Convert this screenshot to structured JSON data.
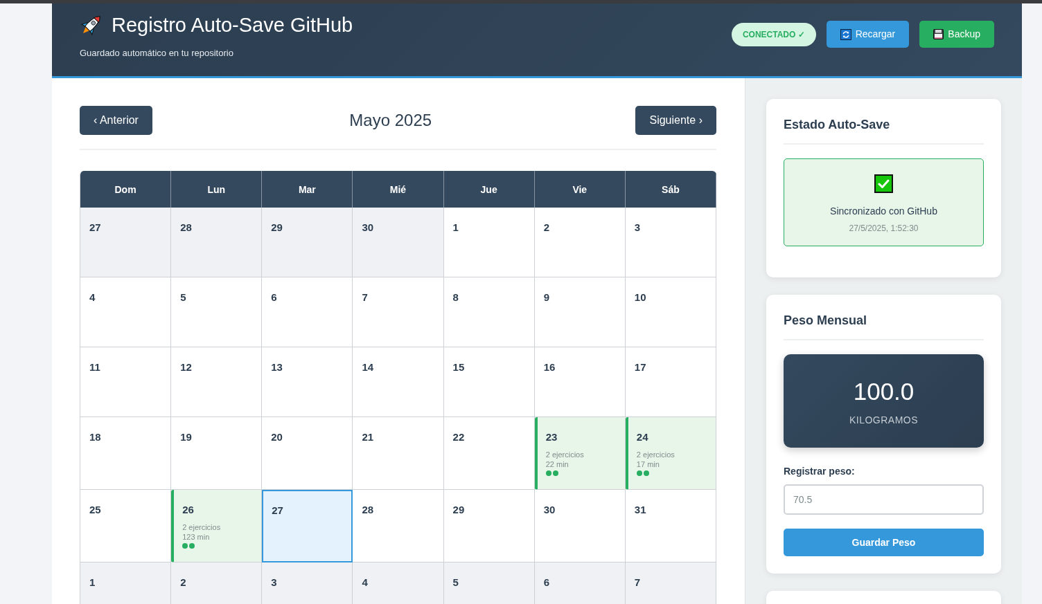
{
  "header": {
    "title": "Registro Auto-Save GitHub",
    "subtitle": "Guardado automático en tu repositorio",
    "status": {
      "label": "CONECTADO ✓",
      "connected": true
    },
    "buttons": [
      {
        "kind": "reload",
        "label": "Recargar"
      },
      {
        "kind": "backup",
        "label": "Backup"
      }
    ]
  },
  "calendar": {
    "prev": "‹ Anterior",
    "month": "Mayo 2025",
    "next": "Siguiente ›",
    "weekdays": [
      "Dom",
      "Lun",
      "Mar",
      "Mié",
      "Jue",
      "Vie",
      "Sáb"
    ],
    "weeks": [
      [
        {
          "day": "27",
          "outside": true,
          "today": false
        },
        {
          "day": "28",
          "outside": true,
          "today": false
        },
        {
          "day": "29",
          "outside": true,
          "today": false
        },
        {
          "day": "30",
          "outside": true,
          "today": false
        },
        {
          "day": "1",
          "outside": false,
          "today": false
        },
        {
          "day": "2",
          "outside": false,
          "today": false
        },
        {
          "day": "3",
          "outside": false,
          "today": false
        }
      ],
      [
        {
          "day": "4",
          "outside": false,
          "today": false
        },
        {
          "day": "5",
          "outside": false,
          "today": false
        },
        {
          "day": "6",
          "outside": false,
          "today": false
        },
        {
          "day": "7",
          "outside": false,
          "today": false
        },
        {
          "day": "8",
          "outside": false,
          "today": false
        },
        {
          "day": "9",
          "outside": false,
          "today": false
        },
        {
          "day": "10",
          "outside": false,
          "today": false
        }
      ],
      [
        {
          "day": "11",
          "outside": false,
          "today": false
        },
        {
          "day": "12",
          "outside": false,
          "today": false
        },
        {
          "day": "13",
          "outside": false,
          "today": false
        },
        {
          "day": "14",
          "outside": false,
          "today": false
        },
        {
          "day": "15",
          "outside": false,
          "today": false
        },
        {
          "day": "16",
          "outside": false,
          "today": false
        },
        {
          "day": "17",
          "outside": false,
          "today": false
        }
      ],
      [
        {
          "day": "18",
          "outside": false,
          "today": false
        },
        {
          "day": "19",
          "outside": false,
          "today": false
        },
        {
          "day": "20",
          "outside": false,
          "today": false
        },
        {
          "day": "21",
          "outside": false,
          "today": false
        },
        {
          "day": "22",
          "outside": false,
          "today": false
        },
        {
          "day": "23",
          "outside": false,
          "today": false,
          "workout": {
            "exercises": "2 ejercicios",
            "duration": "22 min",
            "dots": [
              {
                "color": "#27ae60"
              },
              {
                "color": "#27ae60"
              }
            ]
          }
        },
        {
          "day": "24",
          "outside": false,
          "today": false,
          "workout": {
            "exercises": "2 ejercicios",
            "duration": "17 min",
            "dots": [
              {
                "color": "#27ae60"
              },
              {
                "color": "#27ae60"
              }
            ]
          }
        }
      ],
      [
        {
          "day": "25",
          "outside": false,
          "today": false
        },
        {
          "day": "26",
          "outside": false,
          "today": false,
          "workout": {
            "exercises": "2 ejercicios",
            "duration": "123 min",
            "dots": [
              {
                "color": "#27ae60"
              },
              {
                "color": "#27ae60"
              }
            ]
          }
        },
        {
          "day": "27",
          "outside": false,
          "today": true
        },
        {
          "day": "28",
          "outside": false,
          "today": false
        },
        {
          "day": "29",
          "outside": false,
          "today": false
        },
        {
          "day": "30",
          "outside": false,
          "today": false
        },
        {
          "day": "31",
          "outside": false,
          "today": false
        }
      ],
      [
        {
          "day": "1",
          "outside": true,
          "today": false
        },
        {
          "day": "2",
          "outside": true,
          "today": false
        },
        {
          "day": "3",
          "outside": true,
          "today": false
        },
        {
          "day": "4",
          "outside": true,
          "today": false
        },
        {
          "day": "5",
          "outside": true,
          "today": false
        },
        {
          "day": "6",
          "outside": true,
          "today": false
        },
        {
          "day": "7",
          "outside": true,
          "today": false
        }
      ]
    ]
  },
  "sidebar": {
    "autosave": {
      "title": "Estado Auto-Save",
      "status": {
        "synced": true,
        "label": "Sincronizado con GitHub",
        "time": "27/5/2025, 1:52:30"
      }
    },
    "weight": {
      "title": "Peso Mensual",
      "value": "100.0",
      "unit": "KILOGRAMOS",
      "input_label": "Registrar peso:",
      "placeholder": "70.5",
      "button": "Guardar Peso"
    }
  }
}
